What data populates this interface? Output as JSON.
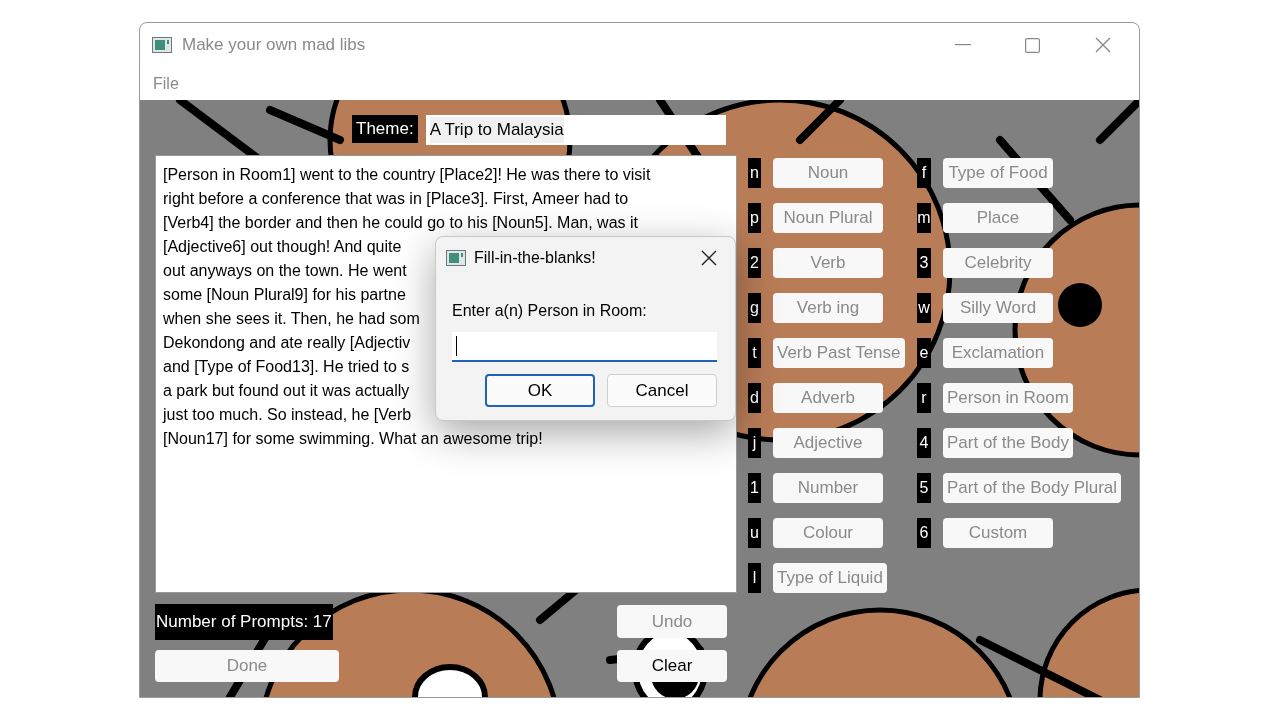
{
  "window": {
    "title": "Make your own mad libs"
  },
  "menu": [
    "File"
  ],
  "theme": {
    "label": "Theme:",
    "value": "A Trip to Malaysia"
  },
  "story_lines": [
    "[Person in Room1] went to the country [Place2]! He was there to visit",
    "right before a conference that was in [Place3]. First, Ameer had to",
    "[Verb4] the border and then he could go to his [Noun5]. Man, was it",
    "[Adjective6] out though! And quite",
    "out anyways on the town. He went",
    "some [Noun Plural9] for his partne",
    "when she sees it. Then, he had som",
    "Dekondong and ate really [Adjectiv",
    "and [Type of Food13]. He tried to s",
    "a park but found out it was actually",
    "just too much. So instead, he [Verb",
    "[Noun17] for some swimming. What an awesome trip!"
  ],
  "word_buttons": [
    {
      "key": "n",
      "label": "Noun",
      "disabled": true
    },
    {
      "key": "f",
      "label": "Type of Food",
      "disabled": true
    },
    {
      "key": "p",
      "label": "Noun Plural",
      "disabled": true
    },
    {
      "key": "m",
      "label": "Place",
      "disabled": true
    },
    {
      "key": "2",
      "label": "Verb",
      "disabled": true
    },
    {
      "key": "3",
      "label": "Celebrity",
      "disabled": true
    },
    {
      "key": "g",
      "label": "Verb ing",
      "disabled": true
    },
    {
      "key": "w",
      "label": "Silly Word",
      "disabled": true
    },
    {
      "key": "t",
      "label": "Verb Past Tense",
      "disabled": true
    },
    {
      "key": "e",
      "label": "Exclamation",
      "disabled": true
    },
    {
      "key": "d",
      "label": "Adverb",
      "disabled": true
    },
    {
      "key": "r",
      "label": "Person in Room",
      "disabled": true
    },
    {
      "key": "j",
      "label": "Adjective",
      "disabled": true
    },
    {
      "key": "4",
      "label": "Part of the Body",
      "disabled": true
    },
    {
      "key": "1",
      "label": "Number",
      "disabled": true
    },
    {
      "key": "5",
      "label": "Part of the Body Plural",
      "disabled": true
    },
    {
      "key": "u",
      "label": "Colour",
      "disabled": true
    },
    {
      "key": "6",
      "label": "Custom",
      "disabled": true
    },
    {
      "key": "l",
      "label": "Type of Liquid",
      "disabled": true
    }
  ],
  "prompt_count": "Number of Prompts: 17",
  "undo_button": {
    "label": "Undo",
    "disabled": true
  },
  "done_button": {
    "label": "Done",
    "disabled": true
  },
  "clear_button": {
    "label": "Clear",
    "disabled": false
  },
  "dialog": {
    "title": "Fill-in-the-blanks!",
    "prompt": "Enter a(n) Person in Room:",
    "buttons": [
      {
        "label": "OK",
        "default": true
      },
      {
        "label": "Cancel",
        "default": false
      }
    ]
  }
}
